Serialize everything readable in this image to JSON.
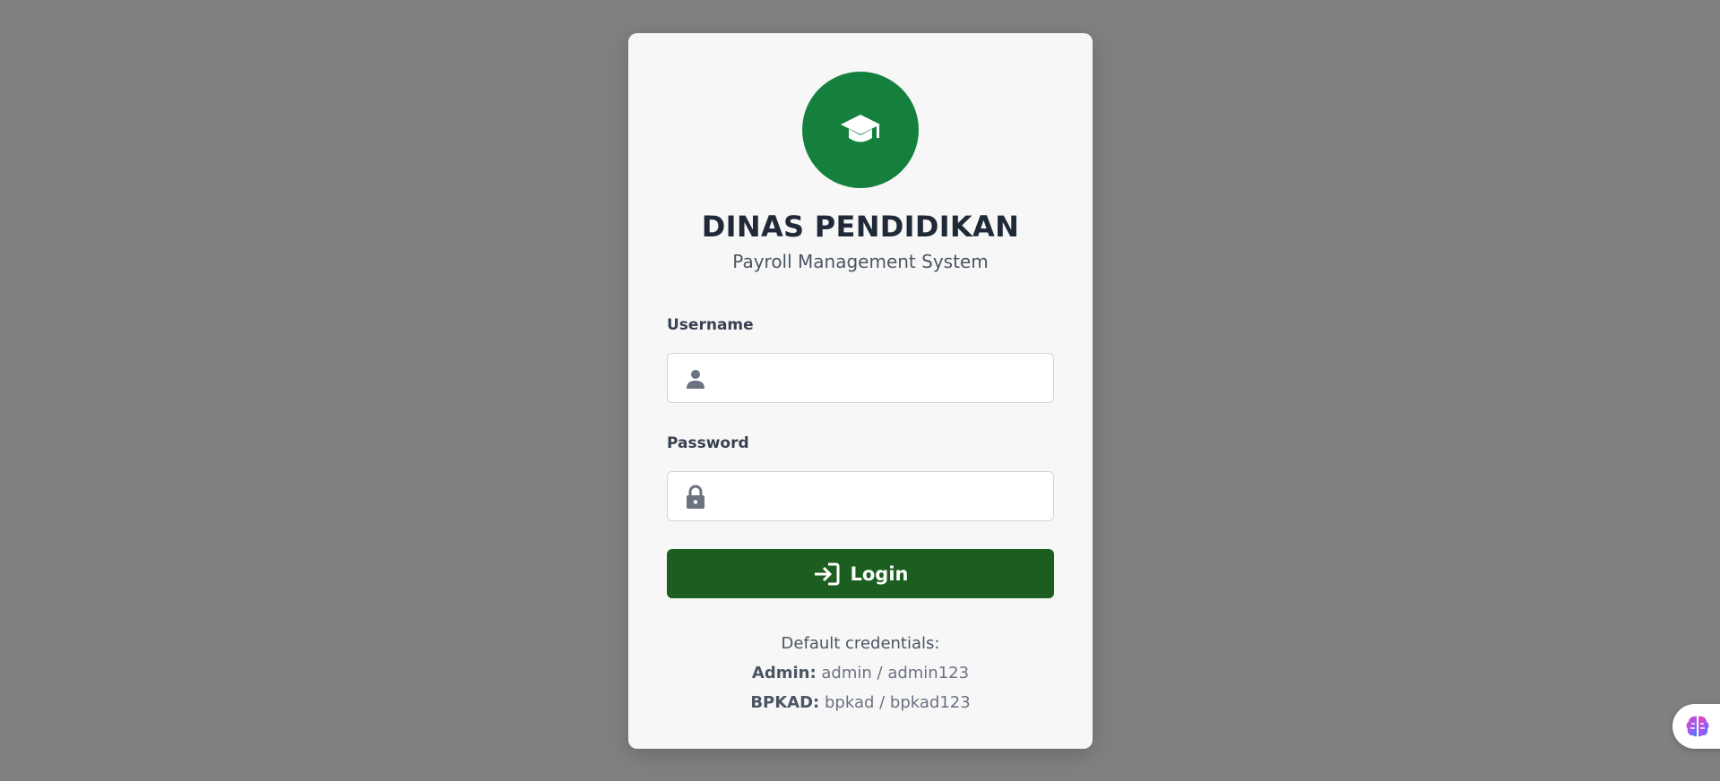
{
  "header": {
    "title": "DINAS PENDIDIKAN",
    "subtitle": "Payroll Management System",
    "logo_icon": "graduation-cap-icon"
  },
  "form": {
    "username": {
      "label": "Username",
      "value": "",
      "placeholder": "",
      "icon": "user-icon"
    },
    "password": {
      "label": "Password",
      "value": "",
      "placeholder": "",
      "icon": "lock-icon"
    },
    "login_button": {
      "label": "Login",
      "icon": "sign-in-icon"
    }
  },
  "credentials": {
    "heading": "Default credentials:",
    "admin": {
      "role": "Admin:",
      "value": "admin / admin123"
    },
    "bpkad": {
      "role": "BPKAD:",
      "value": "bpkad / bpkad123"
    }
  },
  "floating": {
    "icon": "brain-icon"
  },
  "colors": {
    "background": "#808080",
    "card": "#f7f7f7",
    "logo_circle": "#15803d",
    "button": "#1b5e20",
    "title": "#1f2937"
  }
}
